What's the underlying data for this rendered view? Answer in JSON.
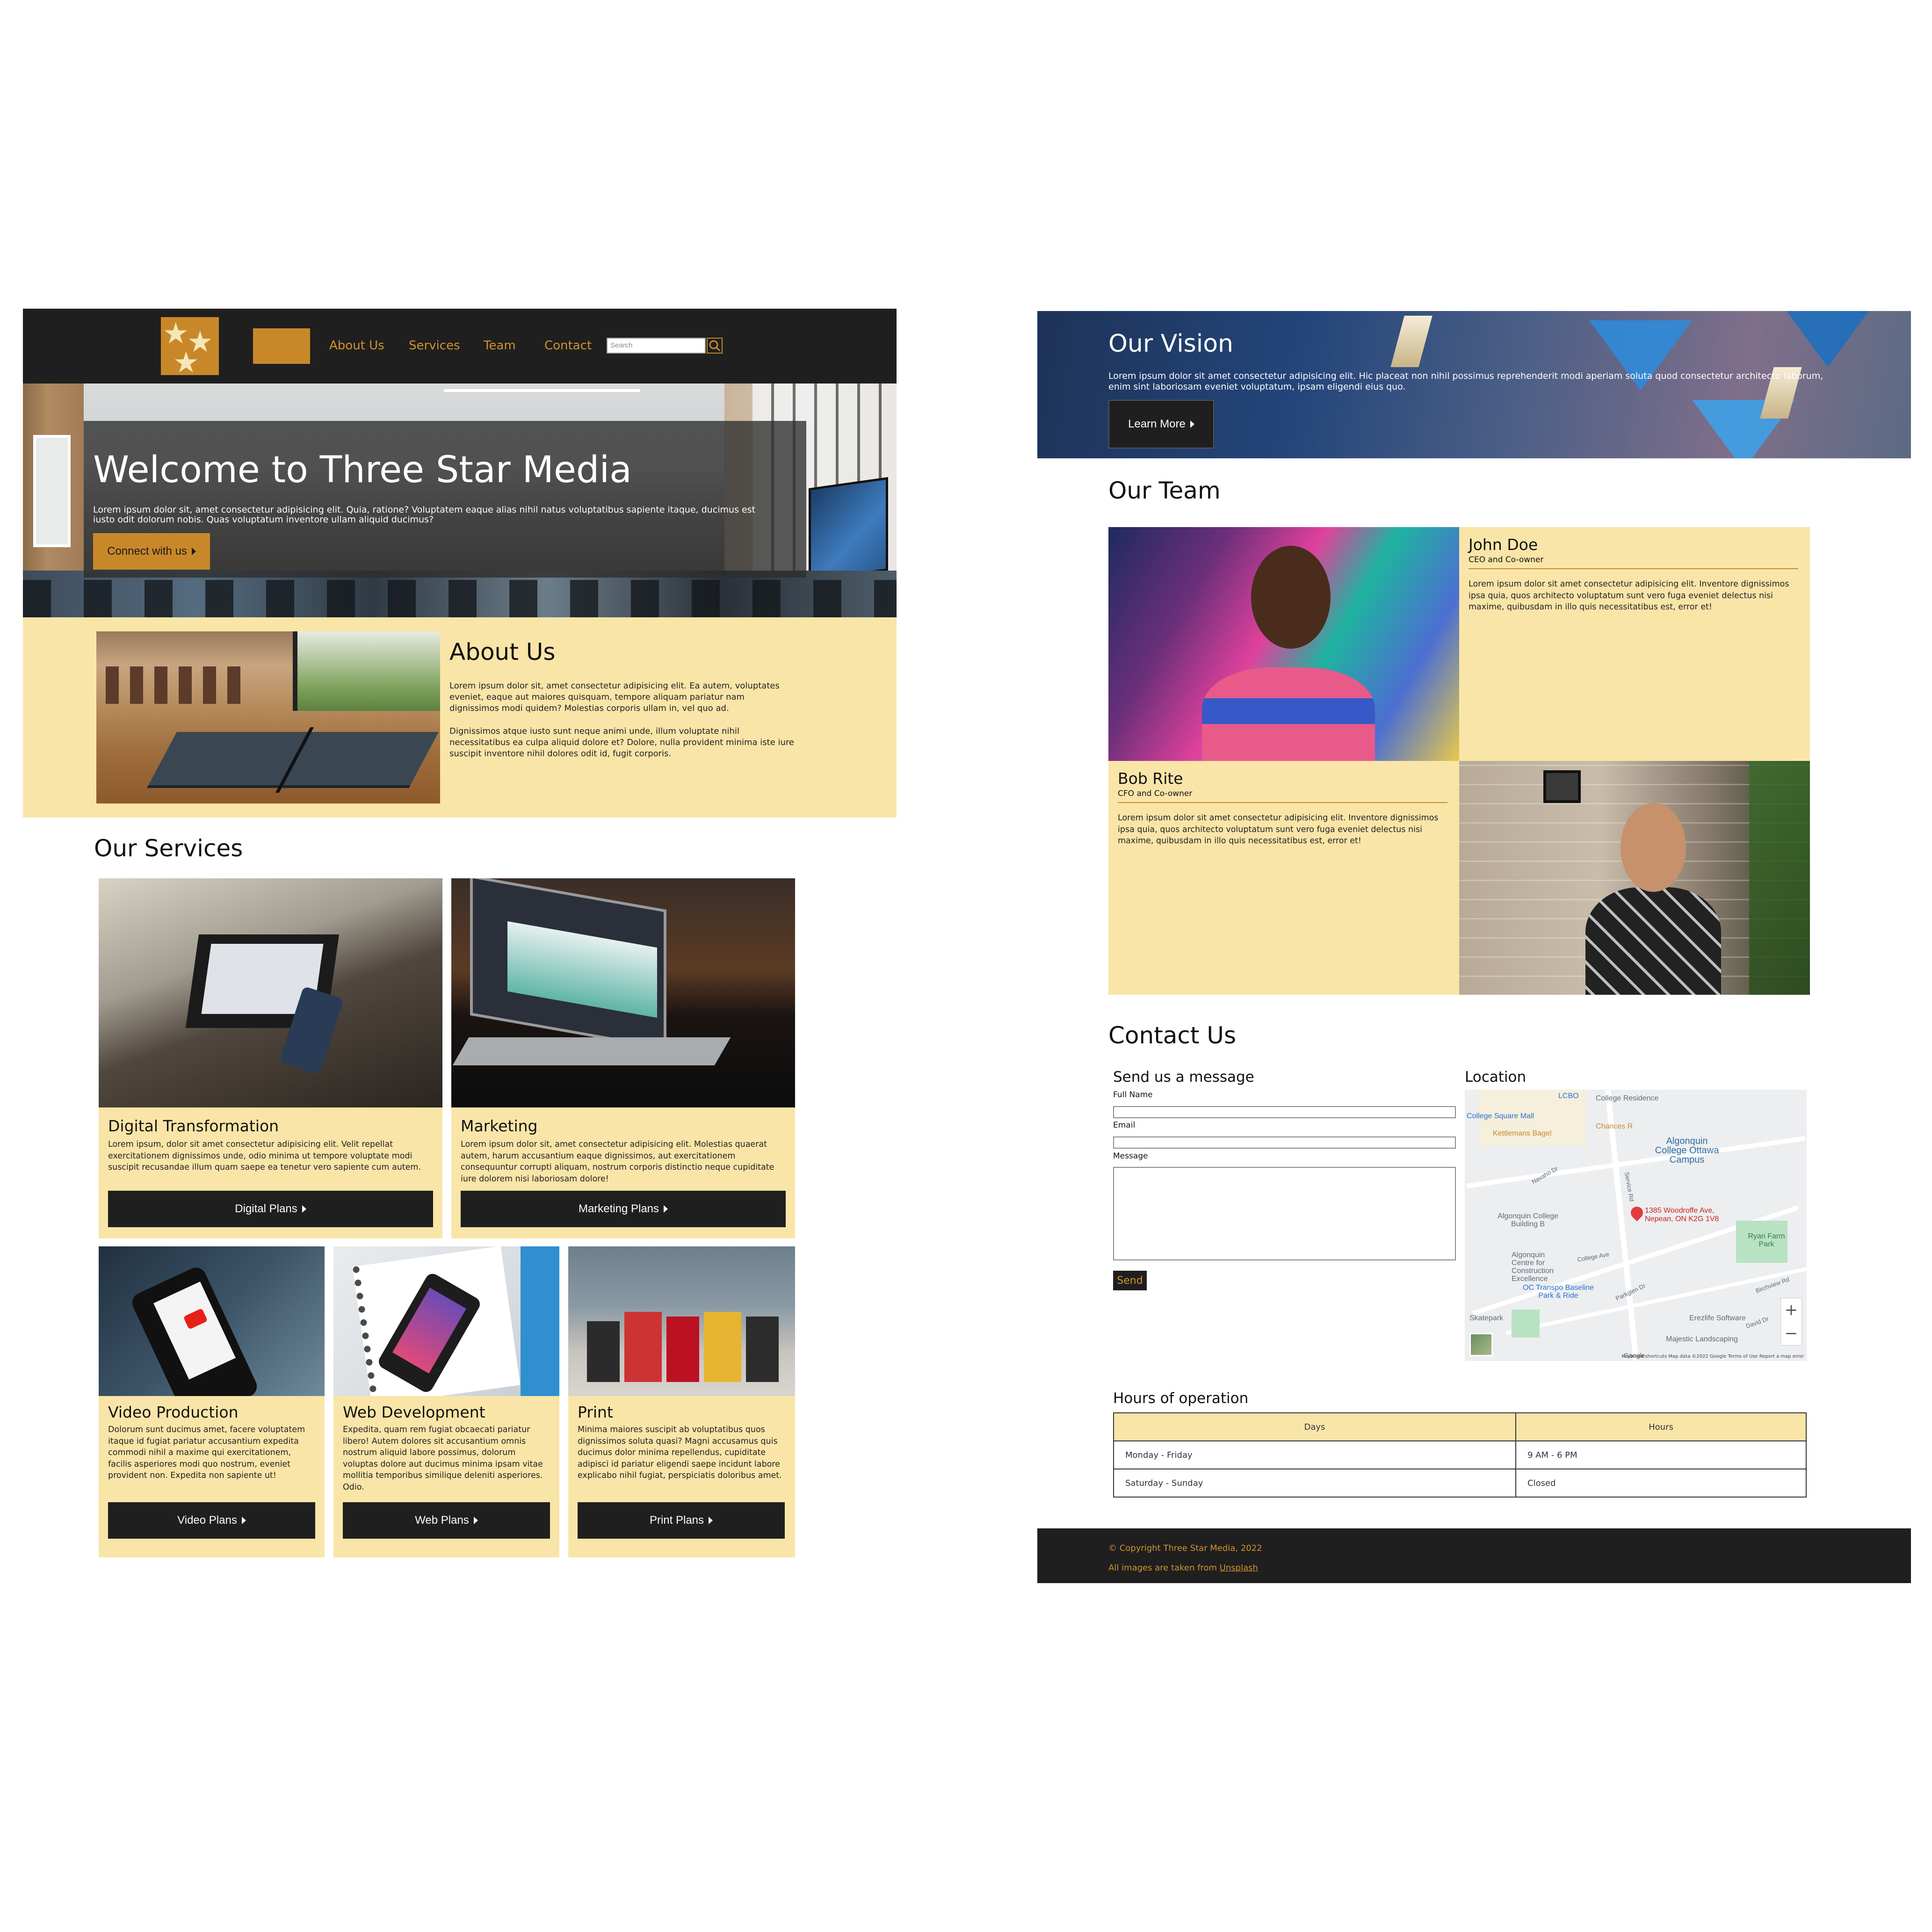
{
  "colors": {
    "dark": "#1f1f1f",
    "accent": "#c8882a",
    "cream": "#fae5a8"
  },
  "nav": {
    "items": [
      "About Us",
      "Services",
      "Team",
      "Contact"
    ],
    "search_placeholder": "Search"
  },
  "hero": {
    "title": "Welcome to Three Star Media",
    "text": "Lorem ipsum dolor sit, amet consectetur adipisicing elit. Quia, ratione? Voluptatem eaque alias nihil natus voluptatibus sapiente itaque, ducimus est iusto odit dolorum nobis. Quas voluptatum inventore ullam aliquid ducimus?",
    "button": "Connect with us"
  },
  "about": {
    "title": "About Us",
    "p1": "Lorem ipsum dolor sit, amet consectetur adipisicing elit. Ea autem, voluptates eveniet, eaque aut maiores quisquam, tempore aliquam pariatur nam dignissimos modi quidem? Molestias corporis ullam in, vel quo ad.",
    "p2": "Dignissimos atque iusto sunt neque animi unde, illum voluptate nihil necessitatibus ea culpa aliquid dolore et? Dolore, nulla provident minima iste iure suscipit inventore nihil dolores odit id, fugit corporis."
  },
  "services": {
    "title": "Our Services",
    "cards": [
      {
        "title": "Digital Transformation",
        "text": "Lorem ipsum, dolor sit amet consectetur adipisicing elit. Velit repellat exercitationem dignissimos unde, odio minima ut tempore voluptate modi suscipit recusandae illum quam saepe ea tenetur vero sapiente cum autem.",
        "button": "Digital Plans"
      },
      {
        "title": "Marketing",
        "text": "Lorem ipsum dolor sit, amet consectetur adipisicing elit. Molestias quaerat autem, harum accusantium eaque dignissimos, aut exercitationem consequuntur corrupti aliquam, nostrum corporis distinctio neque cupiditate iure dolorem nisi laboriosam dolore!",
        "button": "Marketing Plans"
      },
      {
        "title": "Video Production",
        "text": "Dolorum sunt ducimus amet, facere voluptatem itaque id fugiat pariatur accusantium expedita commodi nihil a maxime qui exercitationem, facilis asperiores modi quo nostrum, eveniet provident non. Expedita non sapiente ut!",
        "button": "Video Plans"
      },
      {
        "title": "Web Development",
        "text": "Expedita, quam rem fugiat obcaecati pariatur libero! Autem dolores sit accusantium omnis nostrum aliquid labore possimus, dolorum voluptas dolore aut ducimus minima ipsam vitae mollitia temporibus similique deleniti asperiores. Odio.",
        "button": "Web Plans"
      },
      {
        "title": "Print",
        "text": "Minima maiores suscipit ab voluptatibus quos dignissimos soluta quasi? Magni accusamus quis ducimus dolor minima repellendus, cupiditate adipisci id pariatur eligendi saepe incidunt labore explicabo nihil fugiat, perspiciatis doloribus amet.",
        "button": "Print Plans"
      }
    ]
  },
  "vision": {
    "title": "Our Vision",
    "text": "Lorem ipsum dolor sit amet consectetur adipisicing elit. Hic placeat non nihil possimus reprehenderit modi aperiam soluta quod consectetur architecto laborum, enim sint laboriosam eveniet voluptatum, ipsam eligendi eius quo.",
    "button": "Learn More"
  },
  "team": {
    "title": "Our Team",
    "members": [
      {
        "name": "John Doe",
        "role": "CEO and Co-owner",
        "bio": "Lorem ipsum dolor sit amet consectetur adipisicing elit. Inventore dignissimos ipsa quia, quos architecto voluptatum sunt vero fuga eveniet delectus nisi maxime, quibusdam in illo quis necessitatibus est, error et!"
      },
      {
        "name": "Bob Rite",
        "role": "CFO and Co-owner",
        "bio": "Lorem ipsum dolor sit amet consectetur adipisicing elit. Inventore dignissimos ipsa quia, quos architecto voluptatum sunt vero fuga eveniet delectus nisi maxime, quibusdam in illo quis necessitatibus est, error et!"
      }
    ]
  },
  "contact": {
    "title": "Contact Us",
    "form_title": "Send us a message",
    "full_name_label": "Full Name",
    "email_label": "Email",
    "message_label": "Message",
    "send": "Send",
    "location_title": "Location",
    "map": {
      "labels": [
        "LCBO",
        "College Residence",
        "College Square Mall",
        "Kettlemans Bagel",
        "Chances R",
        "Algonquin College Ottawa Campus",
        "Navaho Dr",
        "Service Rd",
        "Algonquin College Building B",
        "Algonquin Centre for Construction Excellence",
        "College Ave",
        "Ryan Farm Park",
        "OC Transpo Baseline Park & Ride",
        "Parkglen Dr",
        "Erezlife Software",
        "Majestic Landscaping",
        "Birchview Rd",
        "David Dr",
        "Skatepark"
      ],
      "address_line1": "1385 Woodroffe Ave,",
      "address_line2": "Nepean, ON K2G 1V8",
      "zoom_in": "+",
      "zoom_out": "−",
      "attribution": "Keyboard shortcuts   Map data ©2022 Google   Terms of Use   Report a map error",
      "google": "Google"
    }
  },
  "hours": {
    "title": "Hours of operation",
    "headers": [
      "Days",
      "Hours"
    ],
    "rows": [
      [
        "Monday - Friday",
        "9 AM - 6 PM"
      ],
      [
        "Saturday - Sunday",
        "Closed"
      ]
    ]
  },
  "footer": {
    "copyright": "© Copyright Three Star Media, 2022",
    "images_prefix": "All images are taken from ",
    "images_link": "Unsplash"
  }
}
